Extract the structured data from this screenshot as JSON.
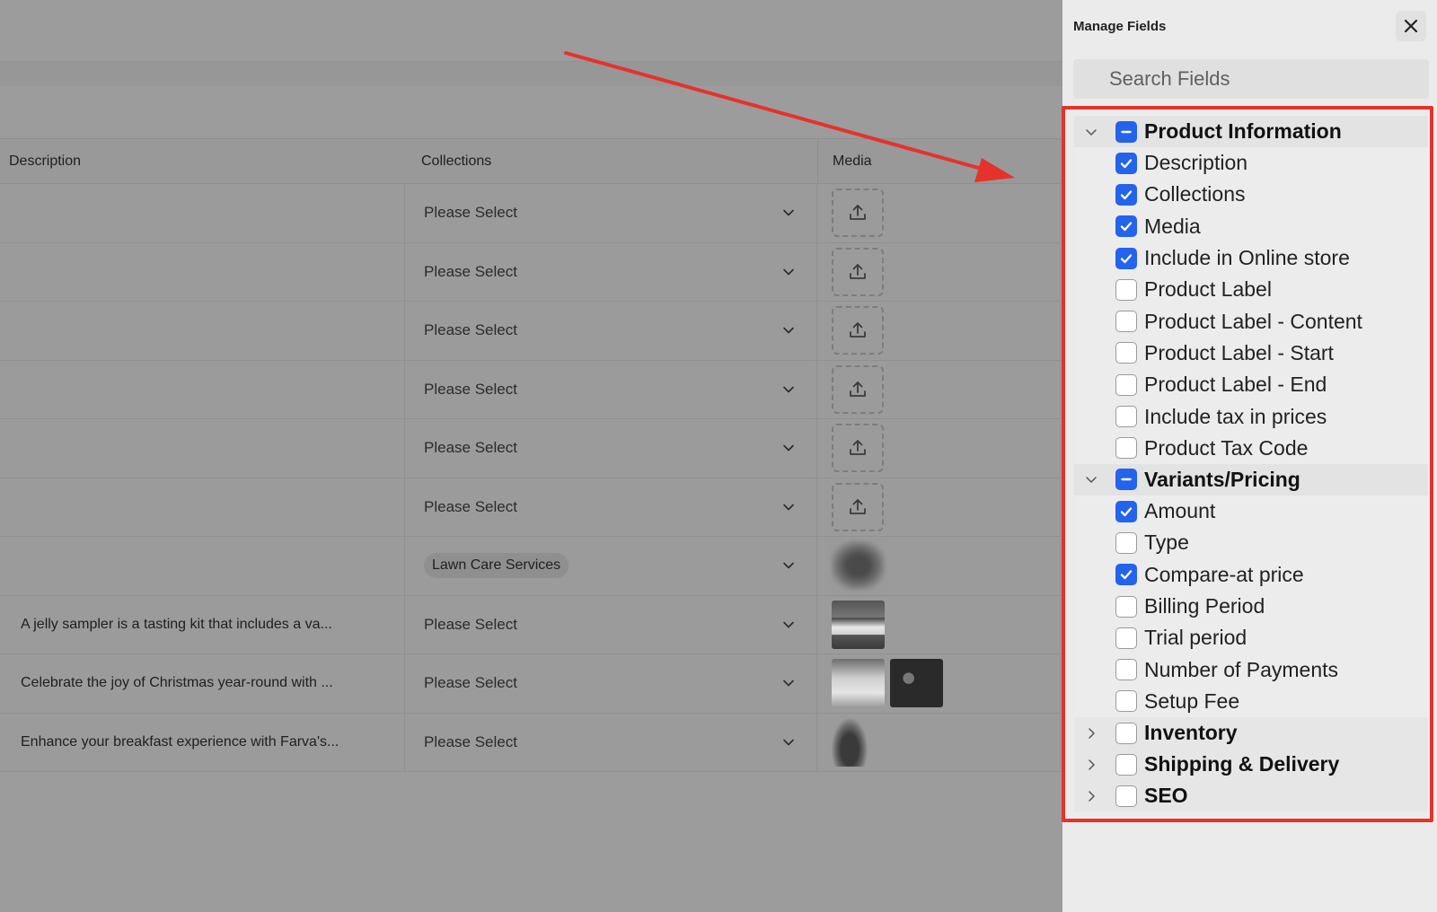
{
  "table": {
    "headers": {
      "description": "Description",
      "collections": "Collections",
      "media": "Media"
    },
    "rows": [
      {
        "description": "",
        "collection": "Please Select",
        "collection_is_tag": false,
        "media": "upload"
      },
      {
        "description": "",
        "collection": "Please Select",
        "collection_is_tag": false,
        "media": "upload"
      },
      {
        "description": "",
        "collection": "Please Select",
        "collection_is_tag": false,
        "media": "upload"
      },
      {
        "description": "",
        "collection": "Please Select",
        "collection_is_tag": false,
        "media": "upload"
      },
      {
        "description": "",
        "collection": "Please Select",
        "collection_is_tag": false,
        "media": "upload"
      },
      {
        "description": "",
        "collection": "Please Select",
        "collection_is_tag": false,
        "media": "upload"
      },
      {
        "description": "",
        "collection": "Lawn Care Services",
        "collection_is_tag": true,
        "media": "blurred-image"
      },
      {
        "description": "A jelly sampler is a tasting kit that includes a va...",
        "collection": "Please Select",
        "collection_is_tag": false,
        "media": "jar-image"
      },
      {
        "description": "Celebrate the joy of Christmas year-round with ...",
        "collection": "Please Select",
        "collection_is_tag": false,
        "media": "box-image+photo-image"
      },
      {
        "description": "Enhance your breakfast experience with Farva's...",
        "collection": "Please Select",
        "collection_is_tag": false,
        "media": "bottle-image"
      }
    ]
  },
  "panel": {
    "title": "Manage Fields",
    "search_placeholder": "Search Fields",
    "groups": [
      {
        "label": "Product Information",
        "expanded": true,
        "state": "mixed",
        "items": [
          {
            "label": "Description",
            "checked": true
          },
          {
            "label": "Collections",
            "checked": true
          },
          {
            "label": "Media",
            "checked": true
          },
          {
            "label": "Include in Online store",
            "checked": true
          },
          {
            "label": "Product Label",
            "checked": false
          },
          {
            "label": "Product Label - Content",
            "checked": false
          },
          {
            "label": "Product Label - Start",
            "checked": false
          },
          {
            "label": "Product Label - End",
            "checked": false
          },
          {
            "label": "Include tax in prices",
            "checked": false
          },
          {
            "label": "Product Tax Code",
            "checked": false
          }
        ]
      },
      {
        "label": "Variants/Pricing",
        "expanded": true,
        "state": "mixed",
        "items": [
          {
            "label": "Amount",
            "checked": true
          },
          {
            "label": "Type",
            "checked": false
          },
          {
            "label": "Compare-at price",
            "checked": true
          },
          {
            "label": "Billing Period",
            "checked": false
          },
          {
            "label": "Trial period",
            "checked": false
          },
          {
            "label": "Number of Payments",
            "checked": false
          },
          {
            "label": "Setup Fee",
            "checked": false
          }
        ]
      },
      {
        "label": "Inventory",
        "expanded": false,
        "state": "off",
        "items": []
      },
      {
        "label": "Shipping & Delivery",
        "expanded": false,
        "state": "off",
        "items": []
      },
      {
        "label": "SEO",
        "expanded": false,
        "state": "off",
        "items": []
      }
    ]
  },
  "colors": {
    "accent": "#2463eb",
    "annotation": "#e5322b",
    "overlay": "#9b9b9b",
    "panel_bg": "#ebebeb"
  }
}
